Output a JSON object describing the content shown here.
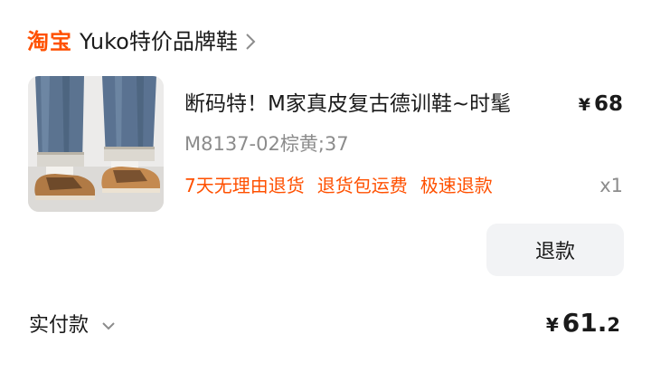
{
  "store": {
    "platform_logo": "淘宝",
    "name": "Yuko特价品牌鞋",
    "chevron_icon": "chevron-right-icon"
  },
  "product": {
    "title": "断码特！M家真皮复古德训鞋~时髦",
    "price_symbol": "¥",
    "price": "68",
    "spec": "M8137-02棕黄;37",
    "service_tags": [
      "7天无理由退货",
      "退货包运费",
      "极速退款"
    ],
    "quantity": "x1",
    "image_icon": "shoes-product-photo"
  },
  "actions": {
    "refund_label": "退款"
  },
  "payment": {
    "label": "实付款",
    "currency": "¥",
    "amount_int": "61.",
    "amount_dec": "2",
    "chevron_icon": "chevron-down-icon"
  },
  "colors": {
    "brand_orange": "#ff5000",
    "text_primary": "#1a1a1a",
    "text_secondary": "#8c8c8c",
    "button_bg": "#f2f3f5"
  }
}
